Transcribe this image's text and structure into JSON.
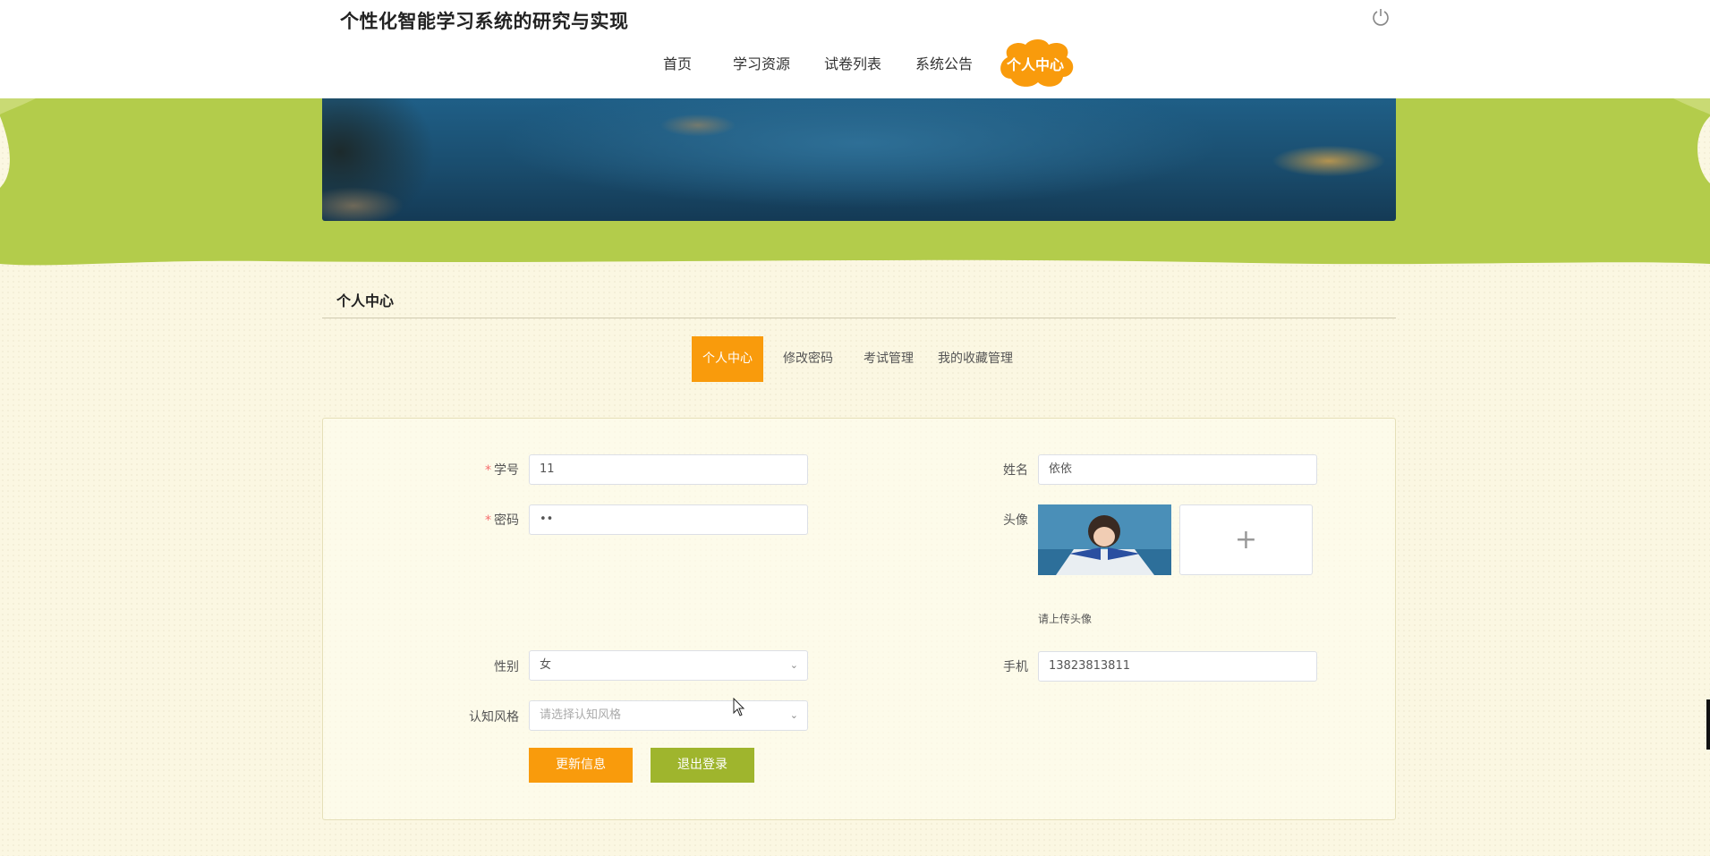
{
  "header": {
    "site_title": "个性化智能学习系统的研究与实现",
    "nav": [
      {
        "label": "首页"
      },
      {
        "label": "学习资源"
      },
      {
        "label": "试卷列表"
      },
      {
        "label": "系统公告"
      },
      {
        "label": "个人中心",
        "active": true
      }
    ],
    "power_icon": "power-icon"
  },
  "section": {
    "title": "个人中心",
    "tabs": [
      {
        "label": "个人中心",
        "active": true
      },
      {
        "label": "修改密码"
      },
      {
        "label": "考试管理"
      },
      {
        "label": "我的收藏管理"
      }
    ]
  },
  "form": {
    "student_id": {
      "label": "学号",
      "required": true,
      "value": "11"
    },
    "password": {
      "label": "密码",
      "required": true,
      "value": "••"
    },
    "name": {
      "label": "姓名",
      "value": "依依"
    },
    "avatar": {
      "label": "头像",
      "upload_icon": "+",
      "hint": "请上传头像"
    },
    "gender": {
      "label": "性别",
      "value": "女"
    },
    "phone": {
      "label": "手机",
      "value": "13823813811"
    },
    "cognitive_style": {
      "label": "认知风格",
      "placeholder": "请选择认知风格"
    },
    "buttons": {
      "update": "更新信息",
      "logout": "退出登录"
    }
  },
  "colors": {
    "accent_orange": "#f99b0c",
    "accent_green": "#9fb52d",
    "band_green": "#b3cc4b",
    "page_bg": "#fbf7e2"
  }
}
